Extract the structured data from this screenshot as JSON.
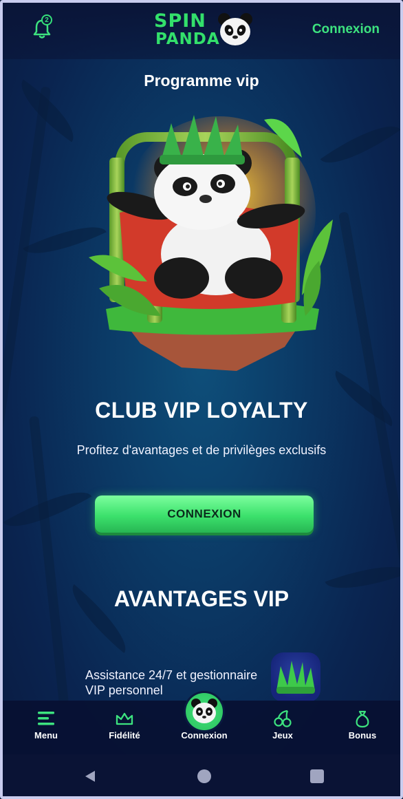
{
  "header": {
    "notification_count": "2",
    "logo_line1": "SPIN",
    "logo_line2": "PANDA",
    "login_label": "Connexion"
  },
  "page_title": "Programme vip",
  "hero": {
    "title": "CLUB VIP LOYALTY",
    "subtitle": "Profitez d'avantages et de privilèges exclusifs",
    "cta_label": "CONNEXION"
  },
  "avantages": {
    "title": "AVANTAGES VIP",
    "features": [
      {
        "text": "Assistance 24/7 et gestionnaire VIP personnel",
        "icon": "leaf-crown-icon"
      }
    ]
  },
  "tabbar": {
    "items": [
      {
        "label": "Menu",
        "icon": "menu-icon"
      },
      {
        "label": "Fidélité",
        "icon": "crown-icon"
      },
      {
        "label": "Connexion",
        "icon": "panda-avatar-icon"
      },
      {
        "label": "Jeux",
        "icon": "cherries-icon"
      },
      {
        "label": "Bonus",
        "icon": "money-bag-icon"
      }
    ]
  },
  "colors": {
    "accent_green": "#3de37f",
    "background": "#0b3a66",
    "tabbar": "#0a1032"
  }
}
